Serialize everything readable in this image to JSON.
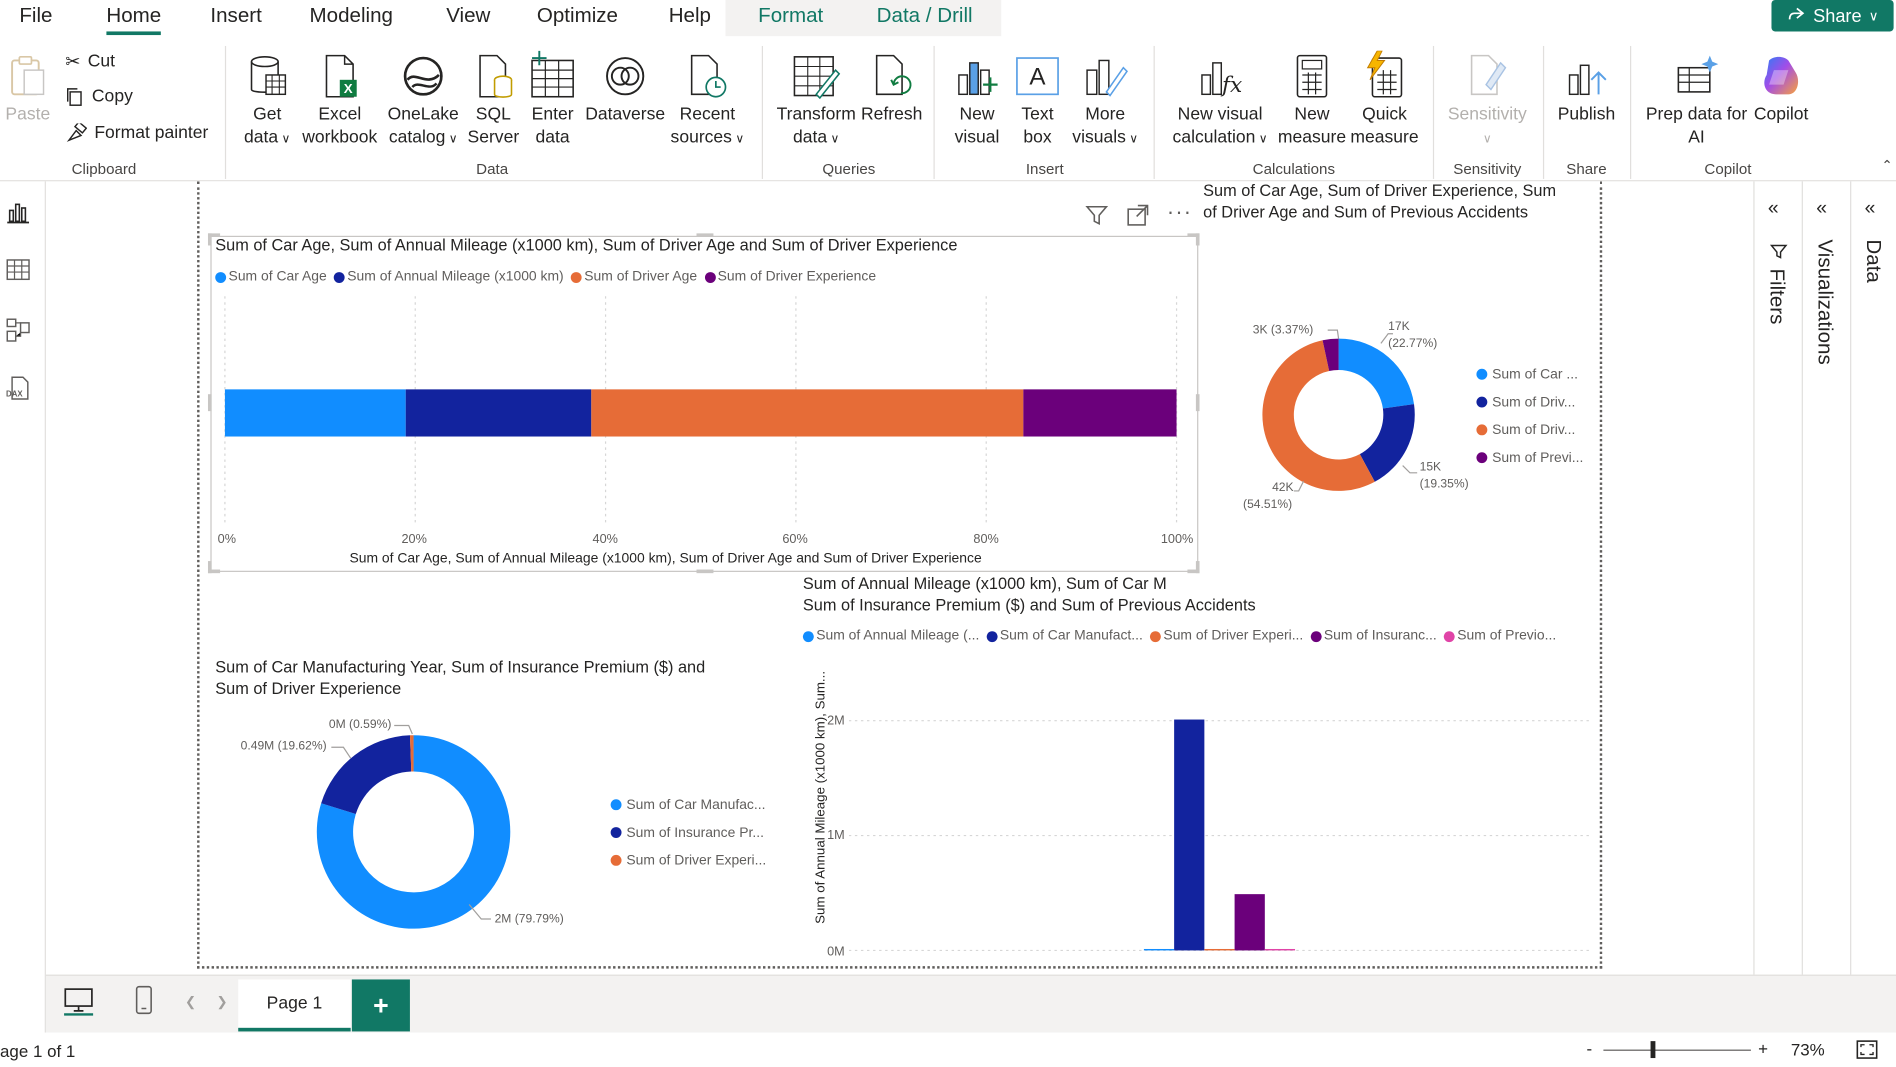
{
  "menu": {
    "tabs": [
      "File",
      "Home",
      "Insert",
      "Modeling",
      "View",
      "Optimize",
      "Help",
      "Format",
      "Data / Drill"
    ],
    "active": "Home",
    "share_label": "Share"
  },
  "ribbon": {
    "clipboard": {
      "paste": "Paste",
      "cut": "Cut",
      "copy": "Copy",
      "format_painter": "Format painter",
      "label": "Clipboard"
    },
    "data": {
      "get_data": [
        "Get",
        "data"
      ],
      "excel": [
        "Excel",
        "workbook"
      ],
      "onelake": [
        "OneLake",
        "catalog"
      ],
      "sql": [
        "SQL",
        "Server"
      ],
      "enter": [
        "Enter",
        "data"
      ],
      "dataverse": [
        "Dataverse"
      ],
      "recent": [
        "Recent",
        "sources"
      ],
      "label": "Data"
    },
    "queries": {
      "transform": [
        "Transform",
        "data"
      ],
      "refresh": [
        "Refresh"
      ],
      "label": "Queries"
    },
    "insert": {
      "new_visual": [
        "New",
        "visual"
      ],
      "text_box": [
        "Text",
        "box"
      ],
      "more_visuals": [
        "More",
        "visuals"
      ],
      "label": "Insert"
    },
    "calculations": {
      "new_visual_calc": [
        "New visual",
        "calculation"
      ],
      "new_measure": [
        "New",
        "measure"
      ],
      "quick_measure": [
        "Quick",
        "measure"
      ],
      "label": "Calculations"
    },
    "sensitivity": {
      "button": [
        "Sensitivity"
      ],
      "label": "Sensitivity"
    },
    "share": {
      "publish": [
        "Publish"
      ],
      "label": "Share"
    },
    "copilot": {
      "prep": [
        "Prep data for",
        "AI"
      ],
      "copilot": [
        "Copilot"
      ],
      "label": "Copilot"
    }
  },
  "colors": {
    "accent": "#117865",
    "series_light_blue": "#118DFF",
    "series_dark_blue": "#12239E",
    "series_orange": "#E66C37",
    "series_purple": "#6B007B",
    "series_pink": "#E044A7"
  },
  "visual1": {
    "title": "Sum of Car Age, Sum of Annual Mileage (x1000 km), Sum of Driver Age and Sum of Driver Experience",
    "legend": [
      "Sum of Car Age",
      "Sum of Annual Mileage (x1000 km)",
      "Sum of Driver Age",
      "Sum of Driver Experience"
    ],
    "x_ticks": [
      "0%",
      "20%",
      "40%",
      "60%",
      "80%",
      "100%"
    ],
    "x_title": "Sum of Car Age, Sum of Annual Mileage (x1000 km), Sum of Driver Age and Sum of Driver Experience"
  },
  "visual2": {
    "title_line1": "Sum of Car Age, Sum of Driver Experience, Sum",
    "title_line2": "of Driver Age and Sum of Previous Accidents",
    "legend": [
      "Sum of Car ...",
      "Sum of Driv...",
      "Sum of Driv...",
      "Sum of Previ..."
    ],
    "labels": {
      "l1a": "17K",
      "l1b": "(22.77%)",
      "l2a": "15K",
      "l2b": "(19.35%)",
      "l3a": "42K",
      "l3b": "(54.51%)",
      "l4": "3K (3.37%)"
    }
  },
  "visual3": {
    "title_line1": "Sum of Car Manufacturing Year, Sum of Insurance Premium ($) and",
    "title_line2": "Sum of Driver Experience",
    "legend": [
      "Sum of Car Manufac...",
      "Sum of Insurance Pr...",
      "Sum of Driver Experi..."
    ],
    "labels": {
      "a": "0M (0.59%)",
      "b": "0.49M (19.62%)",
      "c": "2M (79.79%)"
    }
  },
  "visual4": {
    "title_line1": "Sum of Annual Mileage (x1000 km), Sum of Car M",
    "title_line2": "Sum of Insurance Premium ($) and Sum of Previous Accidents",
    "legend": [
      "Sum of Annual Mileage (...",
      "Sum of Car Manufact...",
      "Sum of Driver Experi...",
      "Sum of Insuranc...",
      "Sum of Previo..."
    ],
    "y_title": "Sum of Annual Mileage (x1000 km), Sum...",
    "y_ticks": [
      "2M",
      "1M",
      "0M"
    ]
  },
  "chart_data": [
    {
      "type": "bar",
      "title": "Sum of Car Age, Sum of Annual Mileage (x1000 km), Sum of Driver Age and Sum of Driver Experience",
      "orientation": "horizontal-100%-stacked",
      "series": [
        {
          "name": "Sum of Car Age",
          "percent": 19.0
        },
        {
          "name": "Sum of Annual Mileage (x1000 km)",
          "percent": 19.5
        },
        {
          "name": "Sum of Driver Age",
          "percent": 45.4
        },
        {
          "name": "Sum of Driver Experience",
          "percent": 16.1
        }
      ],
      "xlim": [
        0,
        100
      ]
    },
    {
      "type": "pie",
      "title": "Sum of Car Age, Sum of Driver Experience, Sum of Driver Age and Sum of Previous Accidents",
      "slices": [
        {
          "name": "Sum of Car ...",
          "value": 17000,
          "percent": 22.77
        },
        {
          "name": "Sum of Driv...",
          "value": 15000,
          "percent": 19.35
        },
        {
          "name": "Sum of Driv...",
          "value": 42000,
          "percent": 54.51
        },
        {
          "name": "Sum of Previ...",
          "value": 3000,
          "percent": 3.37
        }
      ]
    },
    {
      "type": "pie",
      "title": "Sum of Car Manufacturing Year, Sum of Insurance Premium ($) and Sum of Driver Experience",
      "slices": [
        {
          "name": "Sum of Car Manufac...",
          "value": 2000000,
          "percent": 79.79
        },
        {
          "name": "Sum of Insurance Pr...",
          "value": 490000,
          "percent": 19.62
        },
        {
          "name": "Sum of Driver Experi...",
          "value": 0,
          "percent": 0.59
        }
      ]
    },
    {
      "type": "bar",
      "title": "Sum of Annual Mileage (x1000 km), Sum of Car M... Sum of Insurance Premium ($) and Sum of Previous Accidents",
      "series": [
        {
          "name": "Sum of Annual Mileage (...",
          "value": 10000
        },
        {
          "name": "Sum of Car Manufact...",
          "value": 2010000
        },
        {
          "name": "Sum of Driver Experi...",
          "value": 10000
        },
        {
          "name": "Sum of Insuranc...",
          "value": 490000
        },
        {
          "name": "Sum of Previo...",
          "value": 1000
        }
      ],
      "ylim": [
        0,
        2000000
      ],
      "ylabel": "Sum of Annual Mileage (x1000 km), Sum..."
    }
  ],
  "panes": {
    "filters": "Filters",
    "visualizations": "Visualizations",
    "data": "Data"
  },
  "pages": {
    "current": "Page 1",
    "add": "+"
  },
  "status": {
    "page_info": "age 1 of 1",
    "zoom": "73%",
    "zoom_minus": "-",
    "zoom_plus": "+"
  }
}
